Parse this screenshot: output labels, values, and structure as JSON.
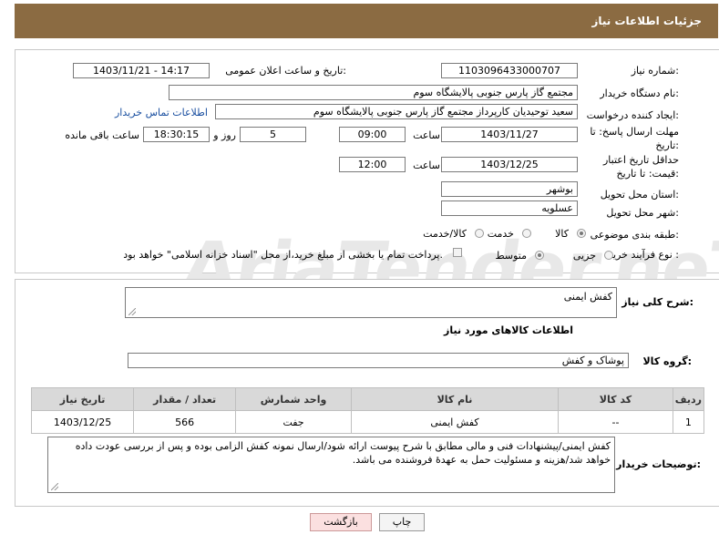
{
  "header": {
    "title": "جزئیات اطلاعات نیاز"
  },
  "watermark": "AriaTender.neT",
  "form": {
    "need_number_label": "شماره نیاز:",
    "need_number": "1103096433000707",
    "announce_label": "تاریخ و ساعت اعلان عمومی:",
    "announce_value": "1403/11/21 - 14:17",
    "buyer_org_label": "نام دستگاه خریدار:",
    "buyer_org": "مجتمع گاز پارس جنوبی  پالایشگاه سوم",
    "requester_label": "ایجاد کننده درخواست:",
    "requester": "سعید توحیدیان کارپرداز مجتمع گاز پارس جنوبی  پالایشگاه سوم",
    "contact_link": "اطلاعات تماس خریدار",
    "deadline_label": "مهلت ارسال پاسخ: تا تاریخ:",
    "deadline_date": "1403/11/27",
    "time_label": "ساعت",
    "deadline_time": "09:00",
    "days_value": "5",
    "days_label": "روز و",
    "remaining_time": "18:30:15",
    "remaining_label": "ساعت باقی مانده",
    "price_validity_label": "حداقل تاریخ اعتبار قیمت: تا تاریخ:",
    "price_validity_date": "1403/12/25",
    "price_validity_time": "12:00",
    "province_label": "استان محل تحویل:",
    "province": "بوشهر",
    "city_label": "شهر محل تحویل:",
    "city": "عسلویه",
    "category_label": "طبقه بندی موضوعی:",
    "category_options": [
      "کالا",
      "خدمت",
      "کالا/خدمت"
    ],
    "process_label": "نوع فرآیند خرید :",
    "process_options": [
      "جزیی",
      "متوسط"
    ],
    "payment_note": "پرداخت تمام یا بخشی از مبلغ خرید،از محل \"اسناد خزانه اسلامی\" خواهد بود."
  },
  "details": {
    "general_desc_label": "شرح کلی نیاز:",
    "general_desc": "کفش ایمنی",
    "goods_info_title": "اطلاعات کالاهای مورد نیاز",
    "goods_group_label": "گروه کالا:",
    "goods_group": "پوشاک و کفش",
    "table": {
      "headers": [
        "ردیف",
        "کد کالا",
        "نام کالا",
        "واحد شمارش",
        "تعداد / مقدار",
        "تاریخ نیاز"
      ],
      "rows": [
        [
          "1",
          "--",
          "کفش ایمنی",
          "جفت",
          "566",
          "1403/12/25"
        ]
      ]
    },
    "buyer_notes_label": "توضیحات خریدار:",
    "buyer_notes": "کفش ایمنی/پیشنهادات فنی و مالی مطابق با شرح پیوست ارائه شود/ارسال نمونه کفش الزامی بوده و پس از بررسی عودت داده خواهد شد/هزینه و مسئولیت حمل به عهدهٔ فروشنده می باشد."
  },
  "buttons": {
    "print": "چاپ",
    "back": "بازگشت"
  }
}
